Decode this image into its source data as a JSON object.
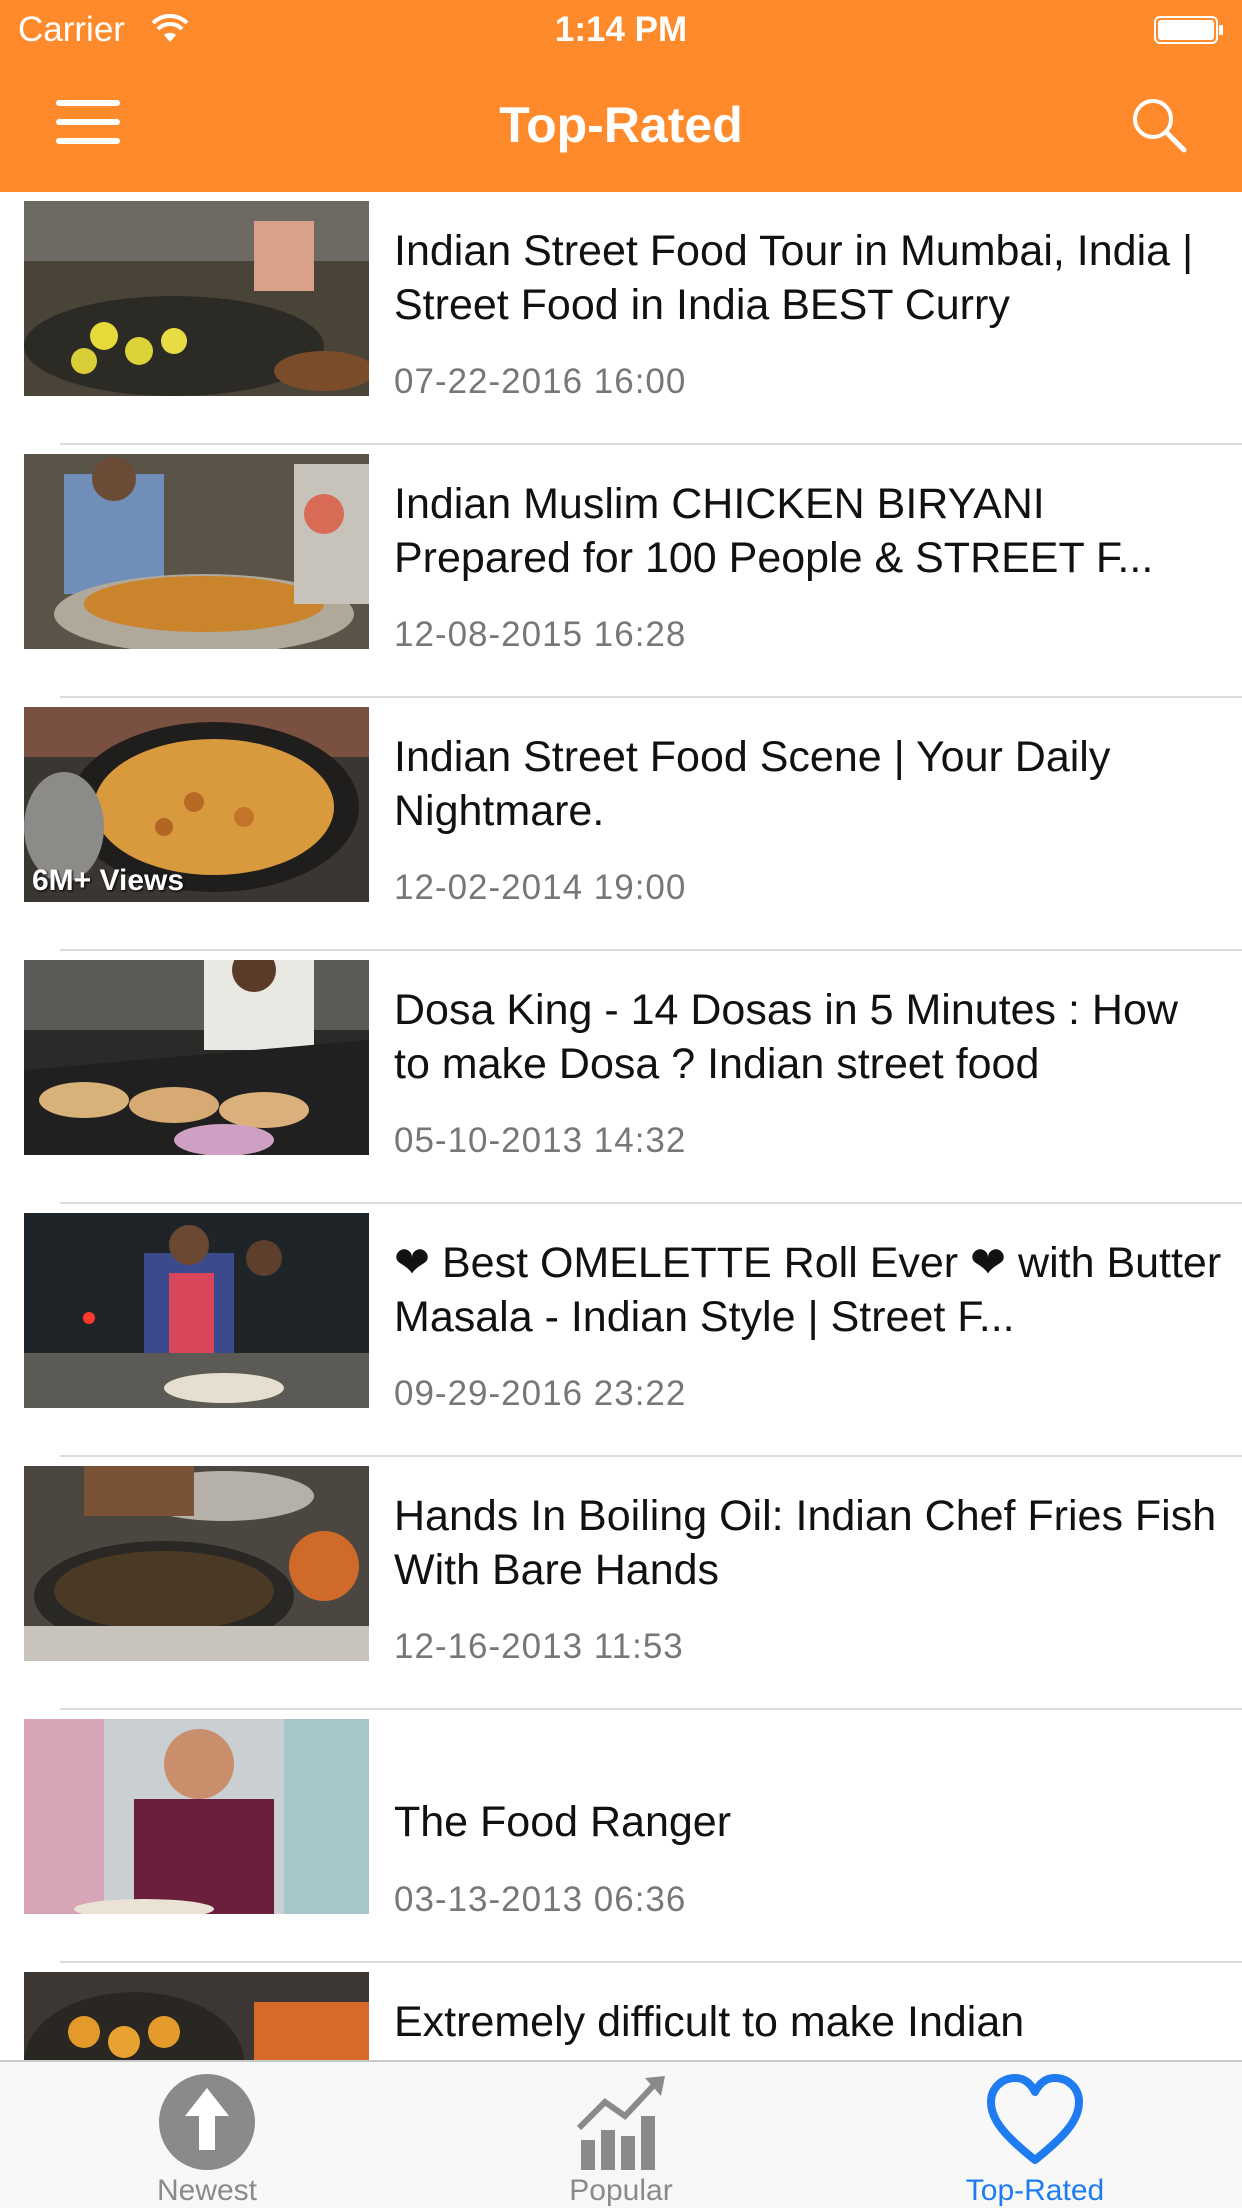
{
  "status_bar": {
    "carrier": "Carrier",
    "time": "1:14 PM"
  },
  "nav": {
    "title": "Top-Rated"
  },
  "videos": [
    {
      "title": "Indian Street Food Tour in Mumbai, India | Street Food in India BEST Curry",
      "date": "07-22-2016 16:00",
      "overlay": ""
    },
    {
      "title": "Indian Muslim CHICKEN BIRYANI Prepared for 100 People & STREET F...",
      "date": "12-08-2015 16:28",
      "overlay": ""
    },
    {
      "title": "Indian Street Food Scene | Your Daily Nightmare.",
      "date": "12-02-2014 19:00",
      "overlay": "6M+ Views"
    },
    {
      "title": "Dosa King - 14 Dosas in 5 Minutes : How to make Dosa ?  Indian street food",
      "date": "05-10-2013 14:32",
      "overlay": ""
    },
    {
      "title": "❤ Best OMELETTE Roll Ever ❤ with Butter Masala - Indian Style | Street F...",
      "date": "09-29-2016 23:22",
      "overlay": ""
    },
    {
      "title": "Hands In Boiling Oil: Indian Chef Fries Fish With Bare Hands",
      "date": "12-16-2013 11:53",
      "overlay": ""
    },
    {
      "title": "The Food Ranger",
      "date": "03-13-2013 06:36",
      "overlay": ""
    },
    {
      "title": "Extremely difficult to make Indian",
      "date": "",
      "overlay": ""
    }
  ],
  "tabs": {
    "newest": "Newest",
    "popular": "Popular",
    "top_rated": "Top-Rated"
  },
  "colors": {
    "accent": "#ff8a2b",
    "tab_active": "#1e7cf0",
    "tab_inactive": "#8a8a8a"
  }
}
